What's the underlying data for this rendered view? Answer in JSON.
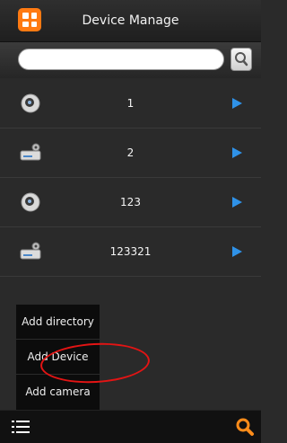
{
  "header": {
    "title": "Device Manage"
  },
  "search": {
    "placeholder": ""
  },
  "devices": [
    {
      "name": "1",
      "icon": "camera-icon"
    },
    {
      "name": "2",
      "icon": "dvr-icon"
    },
    {
      "name": "123",
      "icon": "camera-icon"
    },
    {
      "name": "123321",
      "icon": "dvr-icon"
    }
  ],
  "menu": {
    "items": [
      "Add directory",
      "Add Device",
      "Add camera"
    ]
  },
  "colors": {
    "accent_orange": "#ff7a12",
    "arrow_blue": "#2f92e8",
    "highlight_red": "#e31414"
  }
}
